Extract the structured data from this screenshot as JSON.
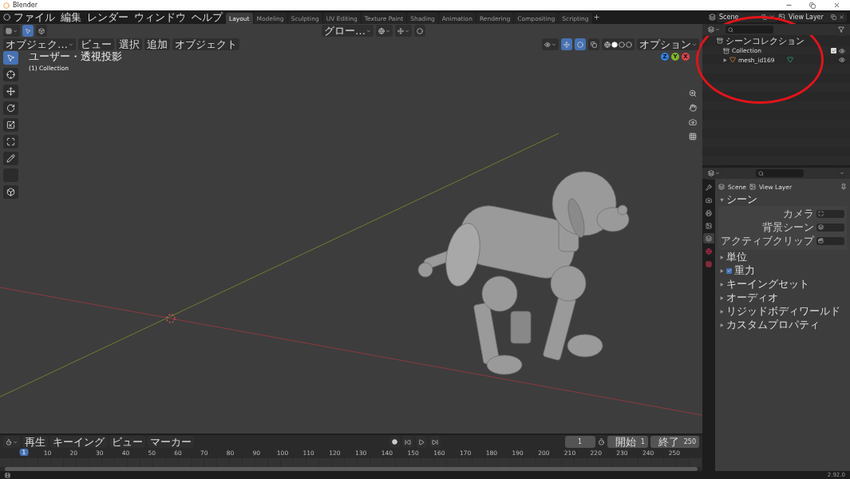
{
  "window": {
    "title": "Blender"
  },
  "menus": [
    "ファイル",
    "編集",
    "レンダー",
    "ウィンドウ",
    "ヘルプ"
  ],
  "workspaces": [
    {
      "label": "Layout",
      "selected": true
    },
    {
      "label": "Modeling",
      "selected": false
    },
    {
      "label": "Sculpting",
      "selected": false
    },
    {
      "label": "UV Editing",
      "selected": false
    },
    {
      "label": "Texture Paint",
      "selected": false
    },
    {
      "label": "Shading",
      "selected": false
    },
    {
      "label": "Animation",
      "selected": false
    },
    {
      "label": "Rendering",
      "selected": false
    },
    {
      "label": "Compositing",
      "selected": false
    },
    {
      "label": "Scripting",
      "selected": false
    }
  ],
  "scene": "Scene",
  "view_layer": "View Layer",
  "viewport": {
    "transform": "グロー…",
    "options": "オプション",
    "mode": "オブジェク…",
    "menus": [
      "ビュー",
      "選択",
      "追加",
      "オブジェクト"
    ],
    "view_name": "ユーザー・透視投影",
    "collection": "(1) Collection",
    "gizmo": [
      "Z",
      "Y",
      "X"
    ],
    "tools": [
      {
        "kind": "select",
        "selected": true
      },
      {
        "kind": "cursor",
        "selected": false
      },
      {
        "kind": "move",
        "selected": false
      },
      {
        "kind": "rotate",
        "selected": false
      },
      {
        "kind": "scale",
        "selected": false
      },
      {
        "kind": "transform",
        "selected": false
      },
      {
        "kind": "annotate",
        "selected": false
      },
      {
        "kind": "measure",
        "selected": false
      },
      {
        "kind": "add-cube",
        "selected": false
      }
    ]
  },
  "outliner": {
    "items": [
      {
        "label": "シーンコレクション",
        "kind": "scene-collection",
        "children": [
          {
            "label": "Collection",
            "kind": "collection",
            "checked": true
          },
          {
            "label": "mesh_id169",
            "kind": "mesh",
            "expanded": false
          }
        ]
      }
    ]
  },
  "properties": {
    "breadcrumb": [
      "Scene",
      "View Layer"
    ],
    "section": {
      "label": "シーン",
      "expanded": true,
      "fields": [
        {
          "label": "カメラ",
          "kind": "camera"
        },
        {
          "label": "背景シーン",
          "kind": "scene"
        },
        {
          "label": "アクティブクリップ",
          "kind": "clip"
        }
      ]
    },
    "panels": [
      {
        "label": "単位",
        "kind": "plain",
        "expanded": false
      },
      {
        "label": "重力",
        "kind": "checkbox",
        "checked": true,
        "expanded": false
      },
      {
        "label": "キーイングセット",
        "kind": "plain",
        "expanded": false
      },
      {
        "label": "オーディオ",
        "kind": "plain",
        "expanded": false
      },
      {
        "label": "リジッドボディワールド",
        "kind": "plain",
        "expanded": false
      },
      {
        "label": "カスタムプロパティ",
        "kind": "plain",
        "expanded": false
      }
    ]
  },
  "timeline": {
    "menus": [
      "再生",
      "キーイング",
      "ビュー",
      "マーカー"
    ],
    "frame": "1",
    "start_label": "開始",
    "start": "1",
    "end_label": "終了",
    "end": "250",
    "current_frame": "1",
    "ticks": [
      "10",
      "20",
      "30",
      "40",
      "50",
      "60",
      "70",
      "80",
      "90",
      "100",
      "110",
      "120",
      "130",
      "140",
      "150",
      "160",
      "170",
      "180",
      "190",
      "200",
      "210",
      "220",
      "230",
      "240",
      "250"
    ]
  },
  "status_bar": {
    "version": "2.92.0"
  }
}
